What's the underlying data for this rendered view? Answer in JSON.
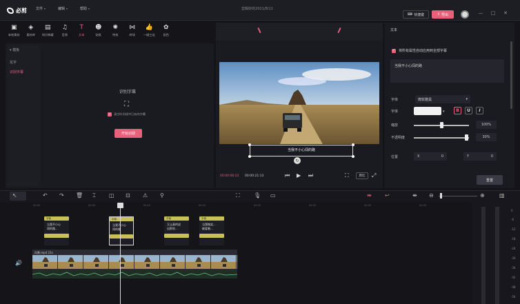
{
  "titlebar": {
    "app_name": "必剪",
    "menus": [
      "文件",
      "编辑",
      "帮助"
    ],
    "project_title": "剪辑好的2021/8/11",
    "shortcut_label": "快捷键",
    "export_label": "导出",
    "window_controls": [
      "—",
      "□",
      "✕"
    ]
  },
  "toolbar": {
    "tools": [
      {
        "label": "本地素材",
        "icon": "folder-icon"
      },
      {
        "label": "素材库",
        "icon": "cube-icon"
      },
      {
        "label": "知识典藏",
        "icon": "book-icon"
      },
      {
        "label": "音频",
        "icon": "music-icon"
      },
      {
        "label": "文本",
        "icon": "text-icon",
        "active": true
      },
      {
        "label": "贴纸",
        "icon": "sticker-icon"
      },
      {
        "label": "特效",
        "icon": "effect-icon"
      },
      {
        "label": "转场",
        "icon": "transition-icon"
      },
      {
        "label": "一键三连",
        "icon": "thumbs-up-icon"
      },
      {
        "label": "画色",
        "icon": "palette-icon"
      }
    ]
  },
  "subnav": {
    "items": [
      {
        "label": "▾ 模板",
        "active": false
      },
      {
        "label": "花字",
        "active": false
      },
      {
        "label": "识别字幕",
        "active": true
      }
    ]
  },
  "caption_panel": {
    "title": "识别字幕",
    "checkbox_label": "清空时间线中已有的字幕",
    "start_label": "开始识别"
  },
  "preview": {
    "subtitle_text": "当我不小心闯的路",
    "time_current": "00:00:06:23",
    "time_total": "00:00:21:13",
    "original_label": "原比"
  },
  "right_panel": {
    "title": "文本",
    "apply_all_label": "将所有属性自动应用到全部字幕",
    "text_value": "当我不小心闯的路",
    "font_label": "字体",
    "font_value": "微软雅黑",
    "style_label": "字体",
    "size_label": "缩放",
    "size_value": "100%",
    "opacity_label": "不透明度",
    "opacity_value": "30%",
    "position_label": "位置",
    "pos_x_axis": "X",
    "pos_x": "0",
    "pos_y_axis": "Y",
    "pos_y": "0",
    "reset_label": "重置",
    "accent_color": "#e8607a",
    "scale_fraction": 0.5,
    "opacity_fraction": 0.95
  },
  "timeline": {
    "ticks": [
      "00:00",
      "00:05",
      "00:10",
      "00:15",
      "00:20",
      "00:25",
      "00:30",
      "00:35",
      "00:40",
      "00:45"
    ],
    "captions": [
      {
        "tag": "字幕",
        "line1": "当我不小心",
        "line2": "闯的路..."
      },
      {
        "tag": "字幕",
        "line1": "当我不小心",
        "line2": "闯的路"
      },
      {
        "tag": "字幕",
        "line1": "又认真的说",
        "line2": "出那些..."
      },
      {
        "tag": "字幕",
        "line1": "当我微笑...",
        "line2": "被爱着..."
      }
    ],
    "video_label": "风景.mp4  21s",
    "meter_labels": [
      "0",
      "-6",
      "-12",
      "-18",
      "-24",
      "-30",
      "-36",
      "-42",
      "-48",
      "-54"
    ]
  }
}
